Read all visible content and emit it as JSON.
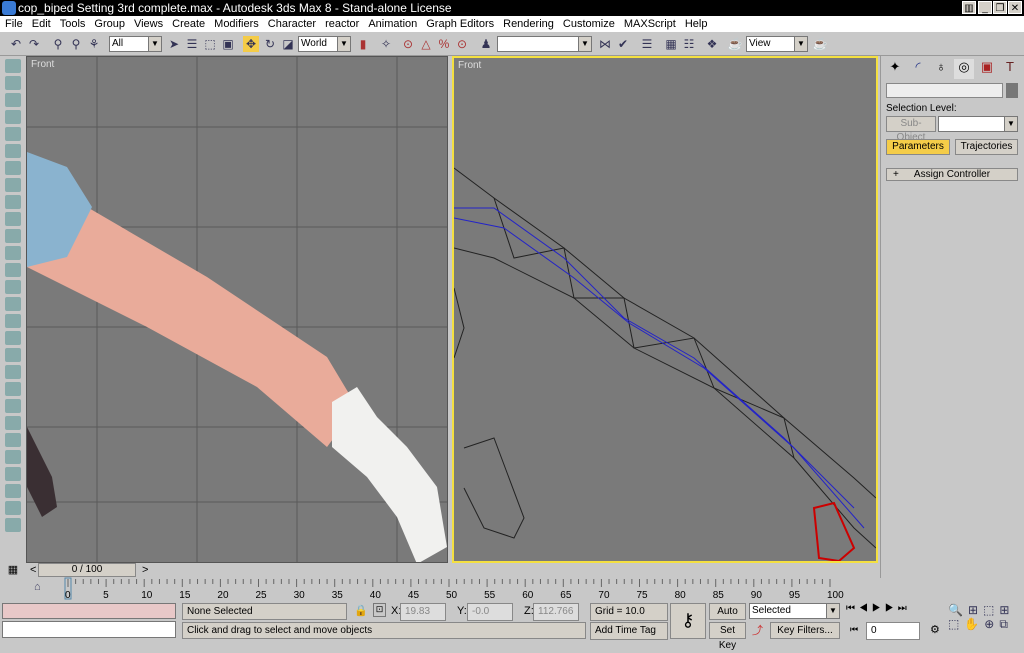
{
  "window": {
    "title": "cop_biped Setting 3rd complete.max - Autodesk 3ds Max 8  - Stand-alone License"
  },
  "menu": [
    "File",
    "Edit",
    "Tools",
    "Group",
    "Views",
    "Create",
    "Modifiers",
    "Character",
    "reactor",
    "Animation",
    "Graph Editors",
    "Rendering",
    "Customize",
    "MAXScript",
    "Help"
  ],
  "toolbar": {
    "selection_filter": "All",
    "ref_coord": "World",
    "named_selection": "",
    "render_type": "View"
  },
  "viewports": {
    "left_label": "Front",
    "right_label": "Front"
  },
  "command_panel": {
    "tabs": [
      "create-icon",
      "modify-icon",
      "hierarchy-icon",
      "motion-icon",
      "display-icon",
      "utilities-icon"
    ],
    "name_field": "",
    "selection_level_label": "Selection Level:",
    "sub_object_label": "Sub-Object",
    "parameters_label": "Parameters",
    "trajectories_label": "Trajectories",
    "rollout_label": "Assign Controller",
    "rollout_toggle": "+",
    "accent": "#f4cc48"
  },
  "timeline": {
    "slider_label": "0 / 100",
    "prev": "<",
    "next": ">",
    "ticks": [
      "0",
      "5",
      "10",
      "15",
      "20",
      "25",
      "30",
      "35",
      "40",
      "45",
      "50",
      "55",
      "60",
      "65",
      "70",
      "75",
      "80",
      "85",
      "90",
      "95",
      "100"
    ]
  },
  "status": {
    "selection": "None Selected",
    "x_label": "X:",
    "x": "19.83",
    "y_label": "Y:",
    "y": "-0.0",
    "z_label": "Z:",
    "z": "112.766",
    "grid": "Grid = 10.0",
    "add_time_tag": "Add Time Tag",
    "prompt": "Click and drag to select and move objects",
    "auto_key": "Auto Key",
    "set_key": "Set Key",
    "key_mode": "Selected",
    "key_filters": "Key Filters...",
    "frame": "0"
  }
}
